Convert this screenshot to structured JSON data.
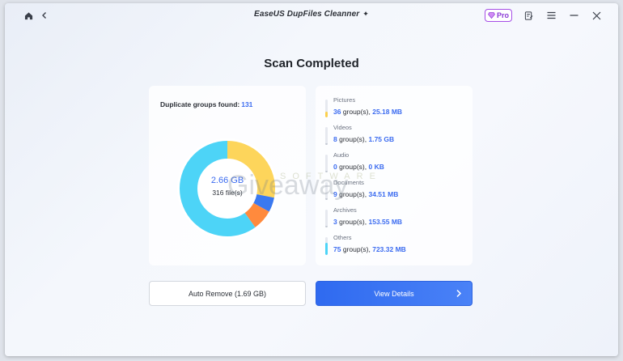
{
  "titlebar": {
    "title": "EaseUS DupFiles Cleanner",
    "pro_label": "Pro"
  },
  "heading": "Scan Completed",
  "summary": {
    "dup_groups_label": "Duplicate groups found:",
    "dup_groups_count": "131",
    "total_size": "2.66 GB",
    "total_files": "316 file(s)"
  },
  "chart_data": {
    "type": "pie",
    "donut": true,
    "categories": [
      "Others",
      "Pictures",
      "Documents",
      "Archives",
      "Videos",
      "Audio"
    ],
    "values": [
      723.32,
      25.18,
      34.51,
      153.55,
      1792,
      0
    ],
    "unit": "MB",
    "colors": [
      "#4dd4f7",
      "#fdd55b",
      "#3a79f0",
      "#ff8a3d",
      "#a8b1bf",
      "#c7cdd6"
    ]
  },
  "categories": [
    {
      "name": "Pictures",
      "groups": "36",
      "groups_suffix": " group(s),",
      "size": "25.18 MB",
      "color": "#fbd04e",
      "fill": 0.3
    },
    {
      "name": "Videos",
      "groups": "8",
      "groups_suffix": " group(s),",
      "size": "1.75 GB",
      "color": "#c3c9d3",
      "fill": 0.1
    },
    {
      "name": "Audio",
      "groups": "0",
      "groups_suffix": " group(s),",
      "size": "0 KB",
      "color": "#c3c9d3",
      "fill": 0.0
    },
    {
      "name": "Documents",
      "groups": "9",
      "groups_suffix": " group(s),",
      "size": "34.51 MB",
      "color": "#c3c9d3",
      "fill": 0.1
    },
    {
      "name": "Archives",
      "groups": "3",
      "groups_suffix": " group(s),",
      "size": "153.55 MB",
      "color": "#c3c9d3",
      "fill": 0.1
    },
    {
      "name": "Others",
      "groups": "75",
      "groups_suffix": " group(s),",
      "size": "723.32 MB",
      "color": "#4dd4f7",
      "fill": 0.7
    }
  ],
  "buttons": {
    "auto_remove": "Auto Remove (1.69 GB)",
    "view_details": "View Details"
  },
  "watermark": {
    "big": "Giveaway",
    "small": "SOFTWARE"
  }
}
